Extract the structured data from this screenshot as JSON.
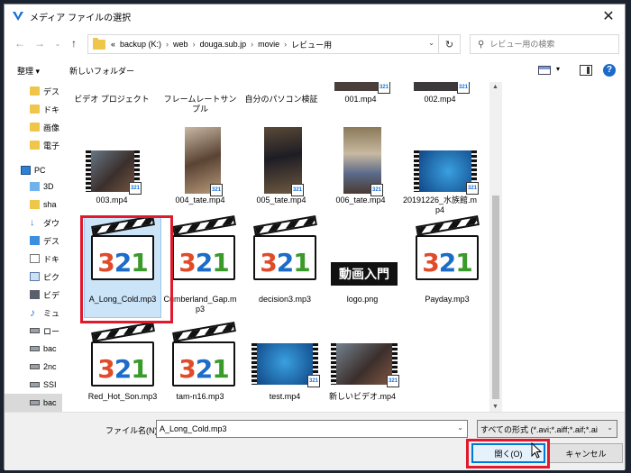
{
  "window": {
    "title": "メディア ファイルの選択",
    "close_glyph": "✕"
  },
  "nav": {
    "breadcrumb": [
      "«",
      "backup (K:)",
      "web",
      "douga.sub.jp",
      "movie",
      "レビュー用"
    ],
    "separator": "›",
    "search_placeholder": "レビュー用の検索"
  },
  "toolbar": {
    "organize": "整理 ▾",
    "new_folder": "新しいフォルダー",
    "help": "?"
  },
  "sidebar": {
    "items": [
      {
        "label": "デス",
        "icon": "folder-icon"
      },
      {
        "label": "ドキ",
        "icon": "folder-icon"
      },
      {
        "label": "画像",
        "icon": "folder-icon"
      },
      {
        "label": "電子",
        "icon": "folder-icon"
      },
      {
        "label": "PC",
        "icon": "pc-icon"
      },
      {
        "label": "3D",
        "icon": "3d-objects-icon"
      },
      {
        "label": "sha",
        "icon": "shared-folder-icon"
      },
      {
        "label": "ダウ",
        "icon": "download-icon"
      },
      {
        "label": "デス",
        "icon": "desktop-icon"
      },
      {
        "label": "ドキ",
        "icon": "documents-icon"
      },
      {
        "label": "ピク",
        "icon": "pictures-icon"
      },
      {
        "label": "ビデ",
        "icon": "videos-icon"
      },
      {
        "label": "ミュ",
        "icon": "music-icon"
      },
      {
        "label": "ロー",
        "icon": "drive-icon"
      },
      {
        "label": "bac",
        "icon": "drive-icon"
      },
      {
        "label": "2nc",
        "icon": "drive-icon"
      },
      {
        "label": "SSI",
        "icon": "drive-icon"
      },
      {
        "label": "bac",
        "icon": "drive-icon"
      }
    ]
  },
  "files": {
    "row0": [
      "ビデオ プロジェクト",
      "フレームレートサンプル",
      "自分のパソコン検証",
      "001.mp4",
      "002.mp4"
    ],
    "row1": [
      "003.mp4",
      "004_tate.mp4",
      "005_tate.mp4",
      "006_tate.mp4",
      "20191226_水族館.mp4"
    ],
    "row2": [
      "A_Long_Cold.mp3",
      "Cumberland_Gap.mp3",
      "decision3.mp3",
      "logo.png",
      "Payday.mp3"
    ],
    "row3": [
      "Red_Hot_Son.mp3",
      "tam-n16.mp3",
      "test.mp4",
      "新しいビデオ.mp4"
    ],
    "logo_text": "動画入門",
    "badge": "321"
  },
  "footer": {
    "filename_label": "ファイル名(N):",
    "filename_value": "A_Long_Cold.mp3",
    "filter_value": "すべての形式 (*.avi;*.aiff;*.aif;*.ai",
    "open_button": "開く(O)",
    "cancel_button": "キャンセル"
  },
  "colors": {
    "highlight": "#e0192c",
    "selection": "#cce4f7",
    "accent": "#0078d7"
  }
}
